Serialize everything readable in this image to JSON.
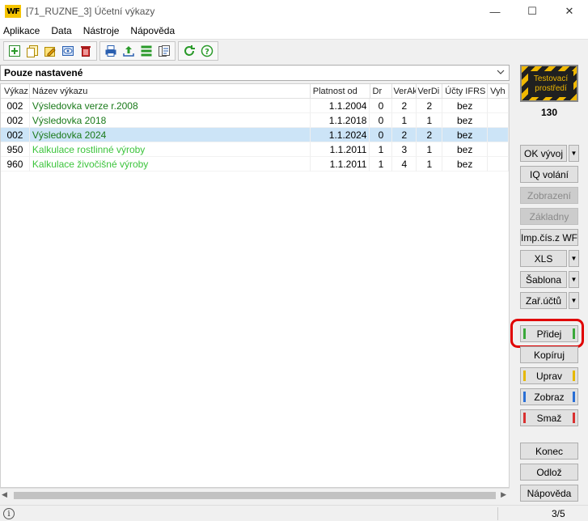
{
  "window": {
    "logo": "WF",
    "title": "[71_RUZNE_3] Účetní výkazy",
    "minimize": "—",
    "maximize": "☐",
    "close": "✕"
  },
  "menu": [
    "Aplikace",
    "Data",
    "Nástroje",
    "Nápověda"
  ],
  "filter": {
    "value": "Pouze nastavené"
  },
  "table": {
    "columns": [
      "Výkaz",
      "Název výkazu",
      "Platnost od",
      "Dr",
      "VerAk",
      "VerDi",
      "Účty IFRS",
      "Vyh"
    ],
    "rows": [
      {
        "code": "002",
        "name": "Výsledovka verze r.2008",
        "valid_from": "1.1.2004",
        "dr": "0",
        "ver_ak": "2",
        "ver_di": "2",
        "ifrs": "bez",
        "style": "dark",
        "selected": false
      },
      {
        "code": "002",
        "name": "Výsledovka 2018",
        "valid_from": "1.1.2018",
        "dr": "0",
        "ver_ak": "1",
        "ver_di": "1",
        "ifrs": "bez",
        "style": "dark",
        "selected": false
      },
      {
        "code": "002",
        "name": "Výsledovka 2024",
        "valid_from": "1.1.2024",
        "dr": "0",
        "ver_ak": "2",
        "ver_di": "2",
        "ifrs": "bez",
        "style": "dark",
        "selected": true
      },
      {
        "code": "950",
        "name": "Kalkulace rostlinné výroby",
        "valid_from": "1.1.2011",
        "dr": "1",
        "ver_ak": "3",
        "ver_di": "1",
        "ifrs": "bez",
        "style": "light",
        "selected": false
      },
      {
        "code": "960",
        "name": "Kalkulace živočišné výroby",
        "valid_from": "1.1.2011",
        "dr": "1",
        "ver_ak": "4",
        "ver_di": "1",
        "ifrs": "bez",
        "style": "light",
        "selected": false
      }
    ]
  },
  "badge": {
    "line1": "Testovací",
    "line2": "prostředí",
    "count": "130"
  },
  "buttons": {
    "ok_vyvoj": "OK vývoj",
    "iq_volani": "IQ volání",
    "zobrazeni": "Zobrazení",
    "zakladny": "Základny",
    "imp_cis": "Imp.čís.z WF",
    "xls": "XLS",
    "sablona": "Šablona",
    "zar_uctu": "Zař.účtů",
    "pridej": "Přidej",
    "kopiruj": "Kopíruj",
    "uprav": "Uprav",
    "zobraz": "Zobraz",
    "smaz": "Smaž",
    "konec": "Konec",
    "odloz": "Odlož",
    "napoveda": "Nápověda"
  },
  "colors": {
    "add": "#3aa83a",
    "edit": "#e6b800",
    "view": "#2a6fd6",
    "delete": "#d93030",
    "highlight": "#e00000"
  },
  "status": {
    "page": "3/5",
    "info": "i"
  }
}
